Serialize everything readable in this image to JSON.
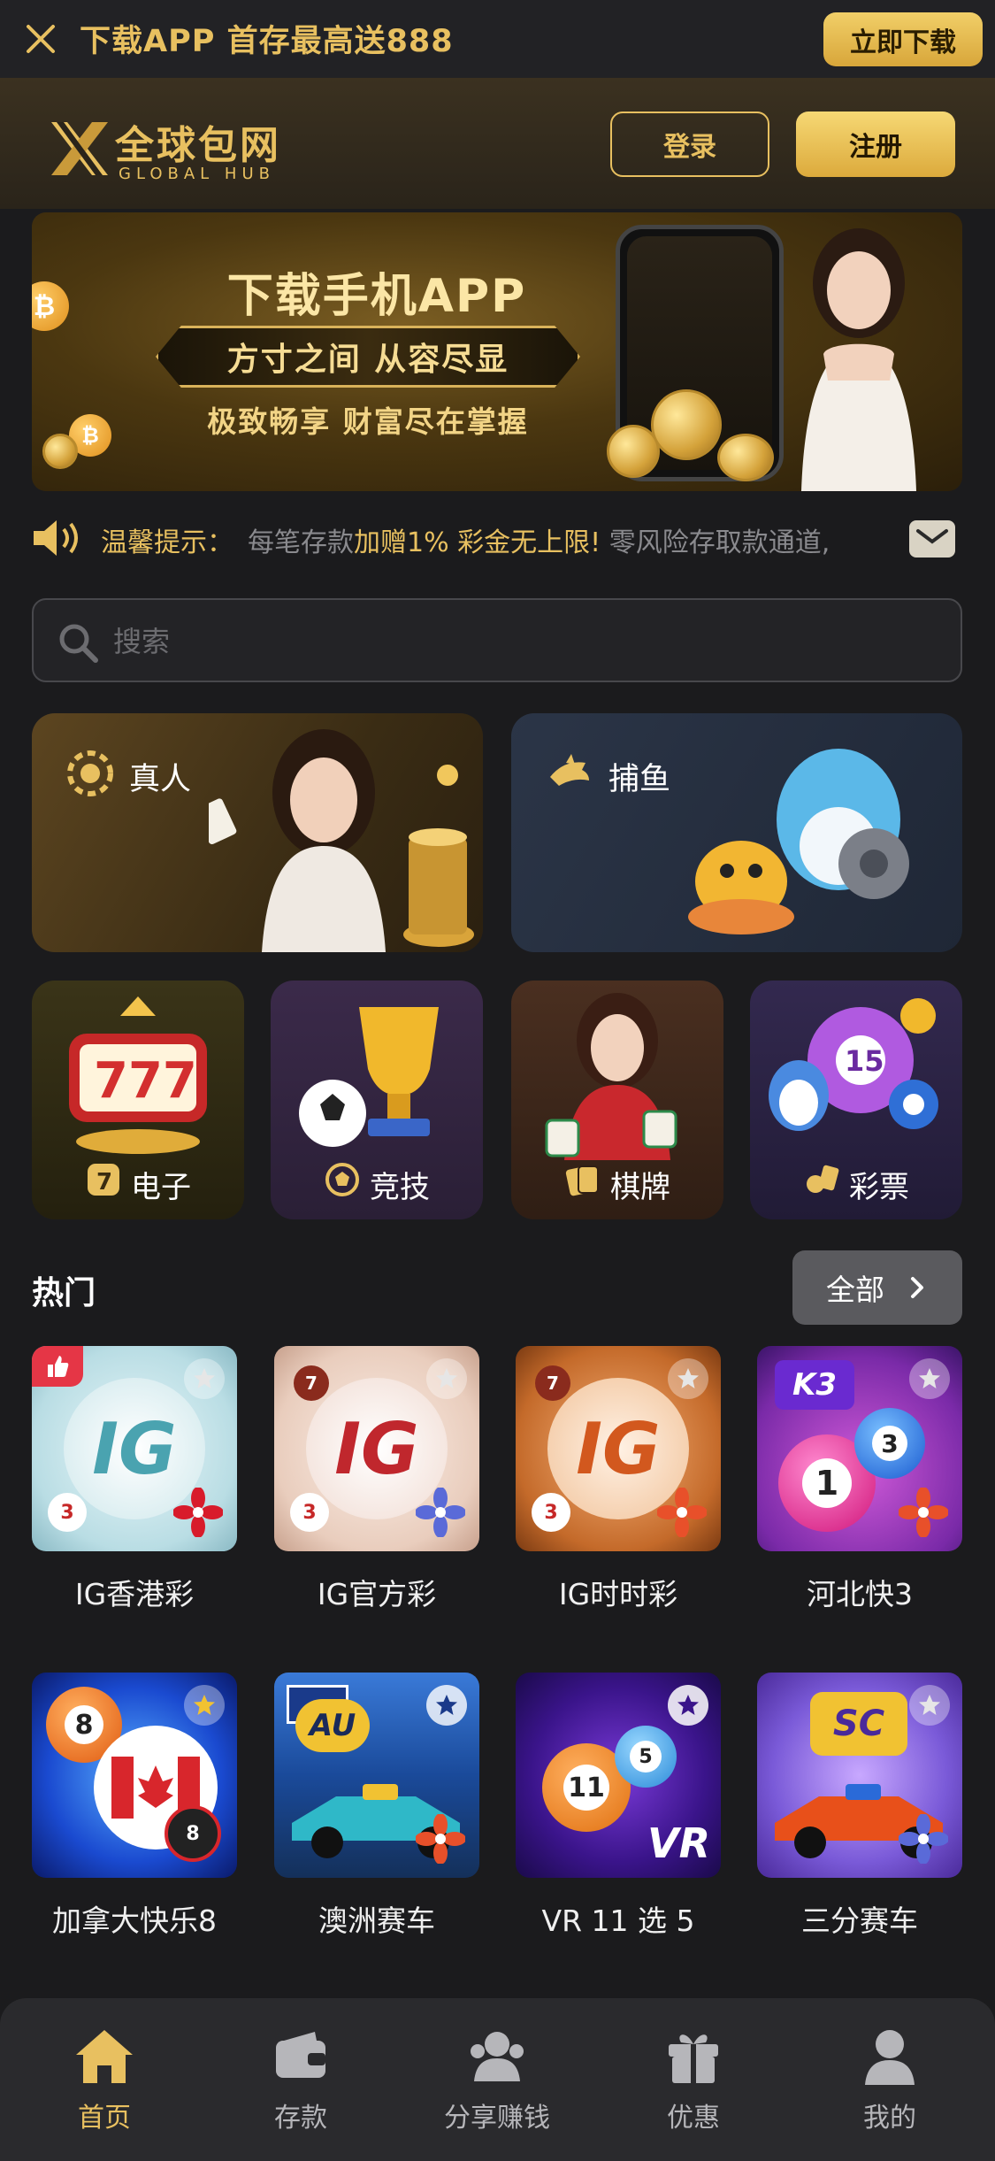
{
  "top_banner": {
    "title": "下载APP 首存最高送888",
    "download_label": "立即下载"
  },
  "header": {
    "logo_cn": "全球包网",
    "logo_en": "GLOBAL HUB",
    "login_label": "登录",
    "register_label": "注册"
  },
  "promo_banner": {
    "title": "下载手机APP",
    "ribbon": "方寸之间 从容尽显",
    "subtitle": "极致畅享 财富尽在掌握"
  },
  "notice": {
    "label": "温馨提示：",
    "text_a": "每笔存款",
    "text_b": "加赠1% 彩金无上限!",
    "text_c": " 零风险存取款通道,"
  },
  "search": {
    "placeholder": "搜索"
  },
  "categories_big": [
    {
      "label": "真人",
      "icon": "chip-icon"
    },
    {
      "label": "捕鱼",
      "icon": "shark-icon"
    }
  ],
  "categories_small": [
    {
      "label": "电子",
      "icon": "slot-7-icon"
    },
    {
      "label": "竞技",
      "icon": "soccer-ball-icon"
    },
    {
      "label": "棋牌",
      "icon": "cards-icon"
    },
    {
      "label": "彩票",
      "icon": "lottery-icon"
    }
  ],
  "hot": {
    "title": "热门",
    "all_label": "全部"
  },
  "games": [
    {
      "name": "IG香港彩"
    },
    {
      "name": "IG官方彩"
    },
    {
      "name": "IG时时彩"
    },
    {
      "name": "河北快3"
    },
    {
      "name": "加拿大快乐8"
    },
    {
      "name": "澳洲赛车"
    },
    {
      "name": "VR 11 选 5"
    },
    {
      "name": "三分赛车"
    }
  ],
  "bottom_nav": [
    {
      "label": "首页",
      "active": true
    },
    {
      "label": "存款"
    },
    {
      "label": "分享赚钱"
    },
    {
      "label": "优惠"
    },
    {
      "label": "我的"
    }
  ],
  "colors": {
    "accent": "#e8c060",
    "background": "#1b1b1d"
  }
}
